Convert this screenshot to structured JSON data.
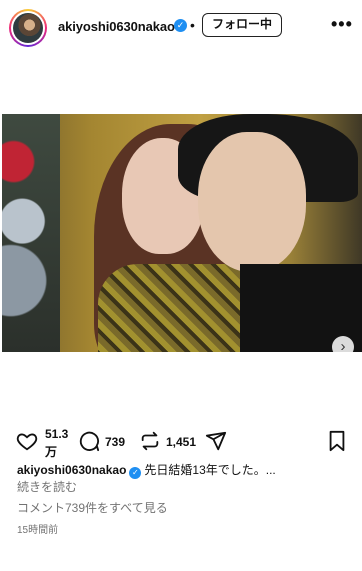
{
  "header": {
    "username": "akiyoshi0630nakao",
    "follow_label": "フォロー中",
    "separator": "•",
    "more_glyph": "•••"
  },
  "post": {
    "carousel_next_glyph": "›"
  },
  "actions": {
    "likes_line1": "51.3",
    "likes_line2": "万",
    "comments": "739",
    "reposts": "1,451"
  },
  "caption": {
    "username": "akiyoshi0630nakao",
    "text": "先日結婚13年でした。...",
    "more_label": "続きを読む",
    "view_comments_label": "コメント739件をすべて見る",
    "timestamp": "15時間前"
  },
  "icons": {
    "verified": "verified-badge-icon",
    "like": "heart-icon",
    "comment": "comment-bubble-icon",
    "repost": "repost-icon",
    "share": "send-icon",
    "save": "bookmark-icon"
  },
  "colors": {
    "verified_blue": "#1f8ff2",
    "secondary_text": "#737373"
  }
}
